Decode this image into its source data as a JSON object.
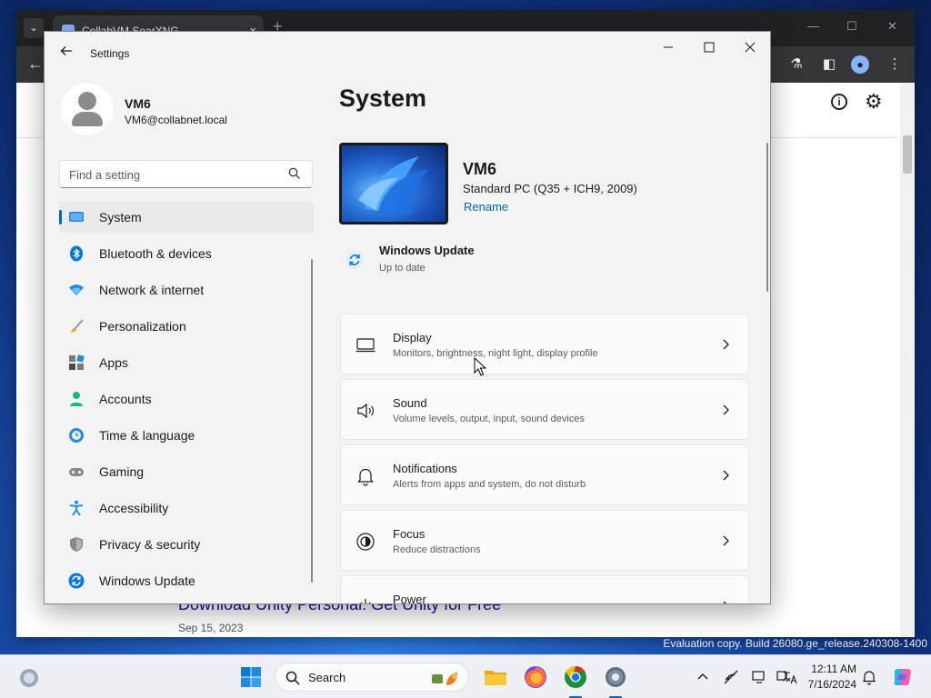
{
  "browser": {
    "tab_title": "CollabVM SearXNG",
    "tab_close": "×",
    "new_tab": "+",
    "result_title": "Download Unity Personal: Get Unity for Free",
    "result_date": "Sep 15, 2023"
  },
  "watermark": "Evaluation copy. Build 26080.ge_release.240308-1400",
  "settings": {
    "app_title": "Settings",
    "user": {
      "name": "VM6",
      "email": "VM6@collabnet.local"
    },
    "search": {
      "placeholder": "Find a setting"
    },
    "nav_items": [
      {
        "label": "System",
        "icon": "system-icon",
        "selected": true
      },
      {
        "label": "Bluetooth & devices",
        "icon": "bluetooth-icon"
      },
      {
        "label": "Network & internet",
        "icon": "wifi-icon"
      },
      {
        "label": "Personalization",
        "icon": "brush-icon"
      },
      {
        "label": "Apps",
        "icon": "apps-icon"
      },
      {
        "label": "Accounts",
        "icon": "accounts-icon"
      },
      {
        "label": "Time & language",
        "icon": "globe-clock-icon"
      },
      {
        "label": "Gaming",
        "icon": "gamepad-icon"
      },
      {
        "label": "Accessibility",
        "icon": "accessibility-icon"
      },
      {
        "label": "Privacy & security",
        "icon": "shield-icon"
      },
      {
        "label": "Windows Update",
        "icon": "windows-update-icon"
      }
    ],
    "page_title": "System",
    "device": {
      "name": "VM6",
      "model": "Standard PC (Q35 + ICH9, 2009)",
      "rename": "Rename"
    },
    "windows_update": {
      "title": "Windows Update",
      "status": "Up to date"
    },
    "cards": [
      {
        "title": "Display",
        "subtitle": "Monitors, brightness, night light, display profile",
        "icon": "display-icon"
      },
      {
        "title": "Sound",
        "subtitle": "Volume levels, output, input, sound devices",
        "icon": "speaker-icon"
      },
      {
        "title": "Notifications",
        "subtitle": "Alerts from apps and system, do not disturb",
        "icon": "bell-icon"
      },
      {
        "title": "Focus",
        "subtitle": "Reduce distractions",
        "icon": "focus-icon"
      },
      {
        "title": "Power",
        "subtitle": "",
        "icon": "power-icon"
      }
    ]
  },
  "taskbar": {
    "search_label": "Search",
    "time": "12:11 AM",
    "date": "7/16/2024"
  },
  "colors": {
    "accent": "#0067c0",
    "settings_bg": "#f3f3f3",
    "card_bg": "#fbfbfb",
    "browser_dark": "#202124"
  }
}
